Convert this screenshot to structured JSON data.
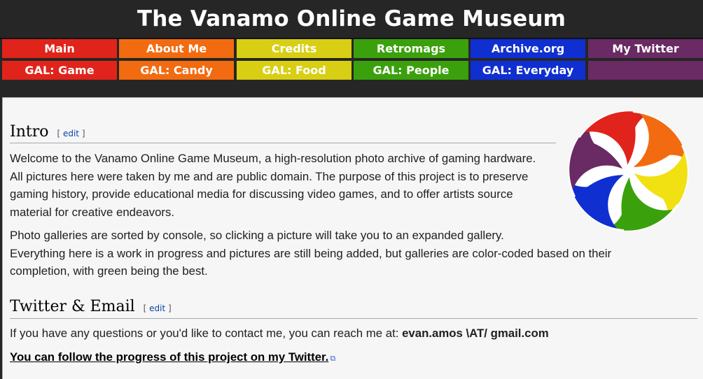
{
  "site": {
    "title": "The Vanamo Online Game Museum"
  },
  "nav": {
    "row1": [
      {
        "label": "Main",
        "color": "#e0241b"
      },
      {
        "label": "About Me",
        "color": "#f26b10"
      },
      {
        "label": "Credits",
        "color": "#d8cf14"
      },
      {
        "label": "Retromags",
        "color": "#3aa10c"
      },
      {
        "label": "Archive.org",
        "color": "#0f2fd1"
      },
      {
        "label": "My Twitter",
        "color": "#6a2a63"
      }
    ],
    "row2": [
      {
        "label": "GAL: Game",
        "color": "#e0241b"
      },
      {
        "label": "GAL: Candy",
        "color": "#f26b10"
      },
      {
        "label": "GAL: Food",
        "color": "#d8cf14"
      },
      {
        "label": "GAL: People",
        "color": "#3aa10c"
      },
      {
        "label": "GAL: Everyday",
        "color": "#0f2fd1"
      },
      {
        "label": "",
        "color": "#6a2a63"
      }
    ]
  },
  "intro": {
    "heading": "Intro",
    "edit_open": "[ ",
    "edit_label": "edit",
    "edit_close": " ]",
    "para1_lines": [
      "Welcome to the Vanamo Online Game Museum, a high-resolution photo archive of gaming hardware.",
      "All pictures here were taken by me and are public domain. The purpose of this project is to preserve",
      "gaming history, provide educational media for discussing video games, and to offer artists source",
      "material for creative endeavors."
    ],
    "para2_lines": [
      "Photo galleries are sorted by console, so clicking a picture will take you to an expanded gallery.",
      "Everything here is a work in progress and pictures are still being added, but galleries are color-coded based on their",
      "completion, with green being the best."
    ]
  },
  "twitter": {
    "heading": "Twitter & Email",
    "edit_label": "edit",
    "contact_text": "If you have any questions or you'd like to contact me, you can reach me at: ",
    "email": "evan.amos \\AT/ gmail.com",
    "follow_link": "You can follow the progress of this project on my Twitter."
  },
  "logo": {
    "name": "rainbow-swirl-logo",
    "colors": [
      "#e0241b",
      "#f26b10",
      "#f1e012",
      "#3aa10c",
      "#0f2fd1",
      "#6a2a63"
    ]
  }
}
